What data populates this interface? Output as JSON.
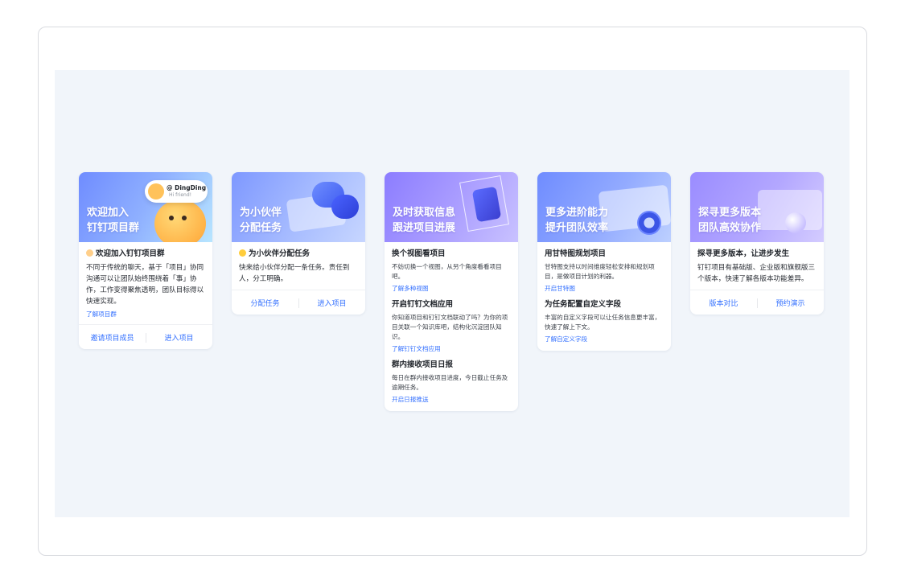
{
  "cards": [
    {
      "banner_title": "欢迎加入\n钉钉项目群",
      "bubble_name": "@ DingDing",
      "bubble_sub": "Hi friend!",
      "title": "欢迎加入钉钉项目群",
      "desc": "不同于传统的聊天，基于「项目」协同沟通可以让团队始终围绕着「事」协作，工作变得聚焦透明，团队目标得以快速实现。",
      "link": "了解项目群",
      "actions": [
        "邀请项目成员",
        "进入项目"
      ]
    },
    {
      "banner_title": "为小伙伴\n分配任务",
      "title": "为小伙伴分配任务",
      "desc": "快来给小伙伴分配一条任务。责任到人，分工明确。",
      "actions": [
        "分配任务",
        "进入项目"
      ]
    },
    {
      "banner_title": "及时获取信息\n跟进项目进展",
      "sections": [
        {
          "title": "换个视图看项目",
          "desc": "不妨切换一个视图，从另个角度看看项目吧。",
          "link": "了解多种视图"
        },
        {
          "title": "开启钉钉文档应用",
          "desc": "你知道项目和钉钉文档联动了吗？为你的项目关联一个知识库吧，结构化沉淀团队知识。",
          "link": "了解钉钉文档应用"
        },
        {
          "title": "群内接收项目日报",
          "desc": "每日在群内接收项目进度，今日截止任务及逾期任务。",
          "link": "开启日报推送"
        }
      ]
    },
    {
      "banner_title": "更多进阶能力\n提升团队效率",
      "sections": [
        {
          "title": "用甘特图规划项目",
          "desc": "甘特图支持以时间维度轻松安排和规划项目，是做项目计划的利器。",
          "link": "开启甘特图"
        },
        {
          "title": "为任务配置自定义字段",
          "desc": "丰富的自定义字段可以让任务信息更丰富，快速了解上下文。",
          "link": "了解自定义字段"
        }
      ]
    },
    {
      "banner_title": "探寻更多版本\n团队高效协作",
      "title": "探寻更多版本，让进步发生",
      "desc": "钉钉项目有基础版、企业版和旗舰版三个版本，快速了解各版本功能差异。",
      "actions": [
        "版本对比",
        "预约演示"
      ]
    }
  ],
  "colors": {
    "link": "#3370ff",
    "canvas": "#f1f5fa"
  }
}
